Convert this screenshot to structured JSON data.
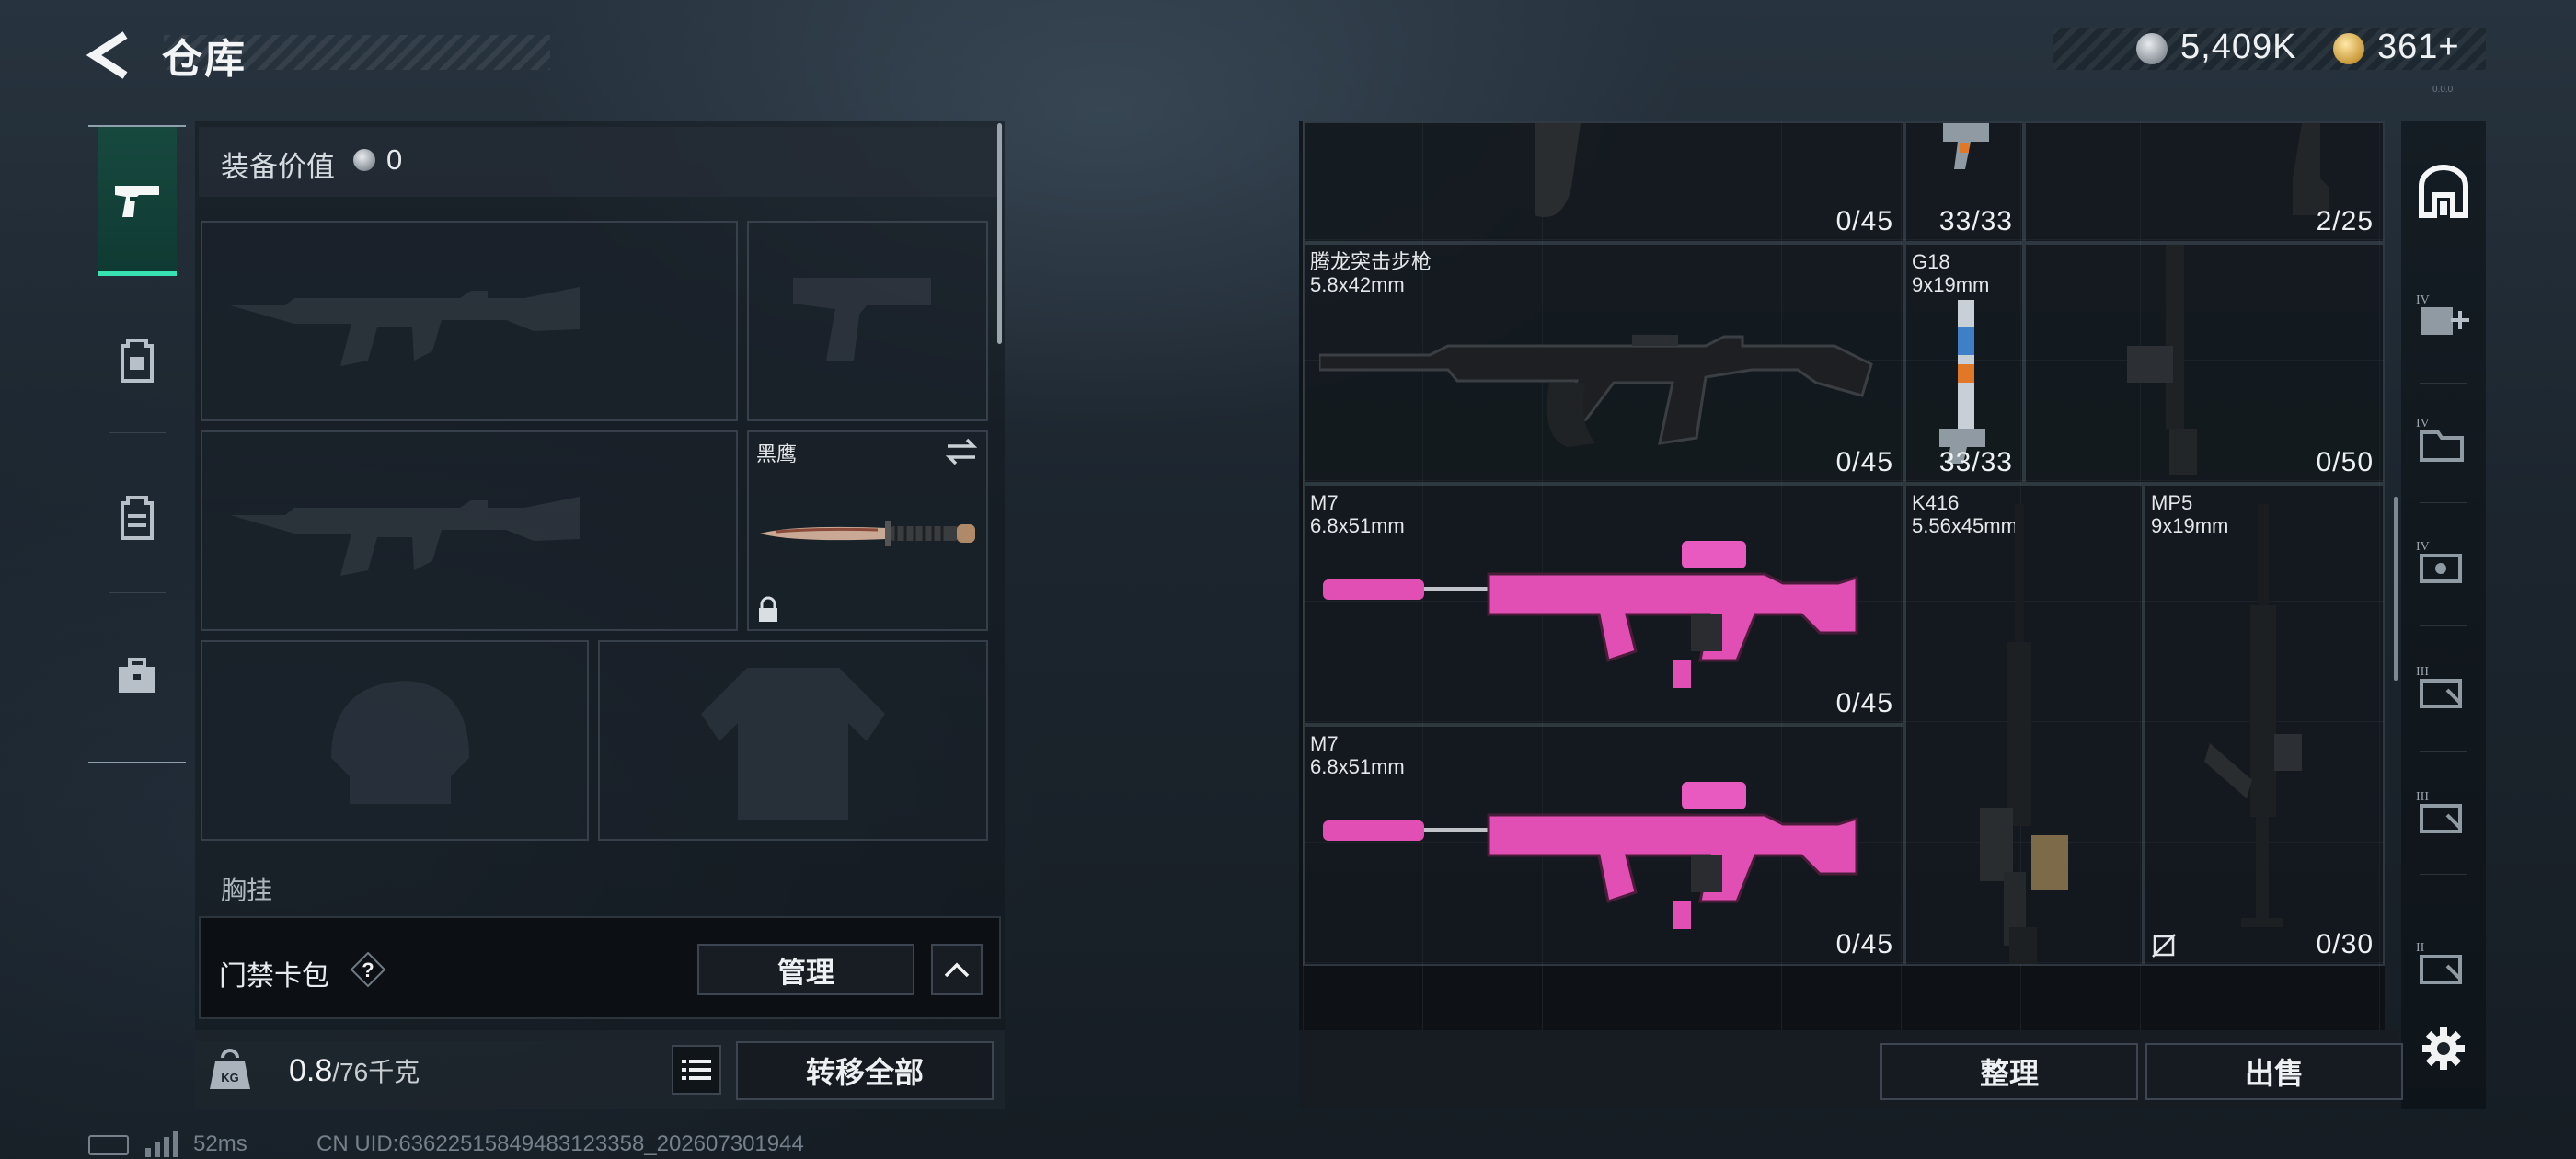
{
  "header": {
    "title": "仓库"
  },
  "currency": {
    "silver": "5,409K",
    "gold": "361+"
  },
  "left_tabs": [
    {
      "name": "weapons-tab",
      "icon": "pistol-icon",
      "active": true
    },
    {
      "name": "gear-tab",
      "icon": "backpack-icon",
      "active": false
    },
    {
      "name": "armor-tab",
      "icon": "vest-icon",
      "active": false
    },
    {
      "name": "case-tab",
      "icon": "toolbox-icon",
      "active": false
    }
  ],
  "equipment": {
    "value_label": "装备价值",
    "value": "0",
    "melee_name": "黑鹰",
    "partial_section_label": "胸挂"
  },
  "keycard": {
    "label": "门禁卡包",
    "help": "?",
    "manage_label": "管理"
  },
  "weight": {
    "current": "0.8",
    "max": "/76千克"
  },
  "transfer_label": "转移全部",
  "status": {
    "ping": "52ms",
    "uid": "CN UID:63622515849483123358_202607301944"
  },
  "stash": {
    "top_row_counts": [
      "0/45",
      "33/33",
      "2/25"
    ],
    "items": [
      {
        "name": "腾龙突击步枪",
        "caliber": "5.8x42mm",
        "count": "0/45"
      },
      {
        "name": "G18",
        "caliber": "9x19mm",
        "count": "33/33"
      },
      {
        "name": "",
        "caliber": "",
        "count": "0/50"
      },
      {
        "name": "M7",
        "caliber": "6.8x51mm",
        "count": "0/45"
      },
      {
        "name": "K416",
        "caliber": "5.56x45mm",
        "count": ""
      },
      {
        "name": "MP5",
        "caliber": "9x19mm",
        "count": "0/30"
      },
      {
        "name": "M7",
        "caliber": "6.8x51mm",
        "count": "0/45"
      }
    ]
  },
  "right_rail_icons": [
    "warehouse-icon",
    "tier-iv-add-icon",
    "tier-iv-folder-icon",
    "tier-iv-case-icon",
    "tier-iii-case-icon",
    "tier-iii-case-2-icon",
    "tier-ii-case-icon",
    "settings-icon"
  ],
  "buttons": {
    "sort": "整理",
    "sell": "出售"
  },
  "colors": {
    "accent": "#38e1b0",
    "pink_skin": "#e24fb4",
    "panel_dark": "#0c1014"
  }
}
